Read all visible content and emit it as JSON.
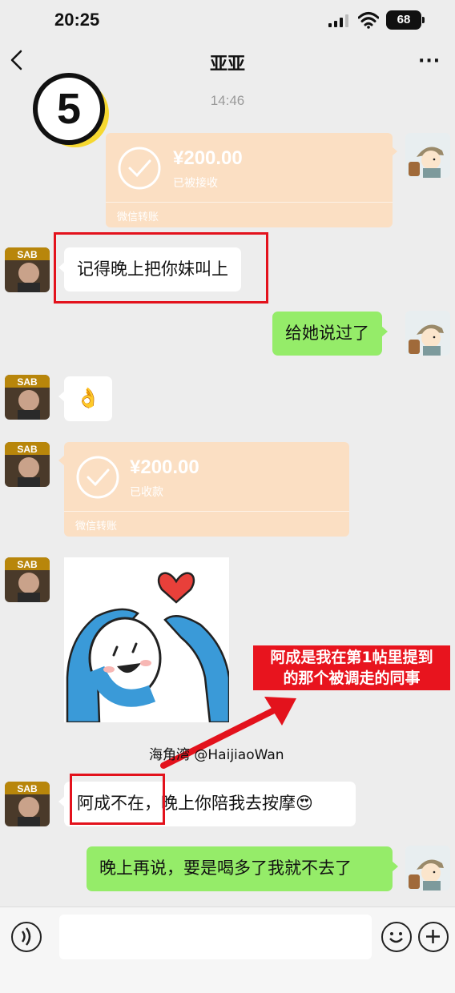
{
  "status_bar": {
    "time": "20:25",
    "battery": "68"
  },
  "nav": {
    "title": "亚亚",
    "more": "···"
  },
  "badge": {
    "number": "5"
  },
  "chat": {
    "timestamp": "14:46",
    "transfer1": {
      "amount": "¥200.00",
      "status": "已被接收",
      "footer": "微信转账"
    },
    "msg1": "记得晚上把你妹叫上",
    "msg2": "给她说过了",
    "msg3_emoji": "👌",
    "transfer2": {
      "amount": "¥200.00",
      "status": "已收款",
      "footer": "微信转账"
    },
    "msg5_part1": "阿成不在，",
    "msg5_part2": "晚上你陪我去按摩",
    "msg5_emoji": "😍",
    "msg6": "晚上再说，要是喝多了我就不去了"
  },
  "annotation": {
    "line1": "阿成是我在第1帖里提到",
    "line2": "的那个被调走的同事"
  },
  "watermark": {
    "text": "海角湾 @HaijiaoWan"
  },
  "colors": {
    "background": "#ededed",
    "green_bubble": "#95ec69",
    "transfer_card": "#fbdfc3",
    "annotation_red": "#e8141e"
  },
  "icons": [
    "back-arrow-icon",
    "more-icon",
    "check-circle-icon",
    "voice-icon",
    "emoji-icon",
    "plus-icon",
    "signal-icon",
    "wifi-icon",
    "battery-icon",
    "heart-icon",
    "red-arrow"
  ]
}
